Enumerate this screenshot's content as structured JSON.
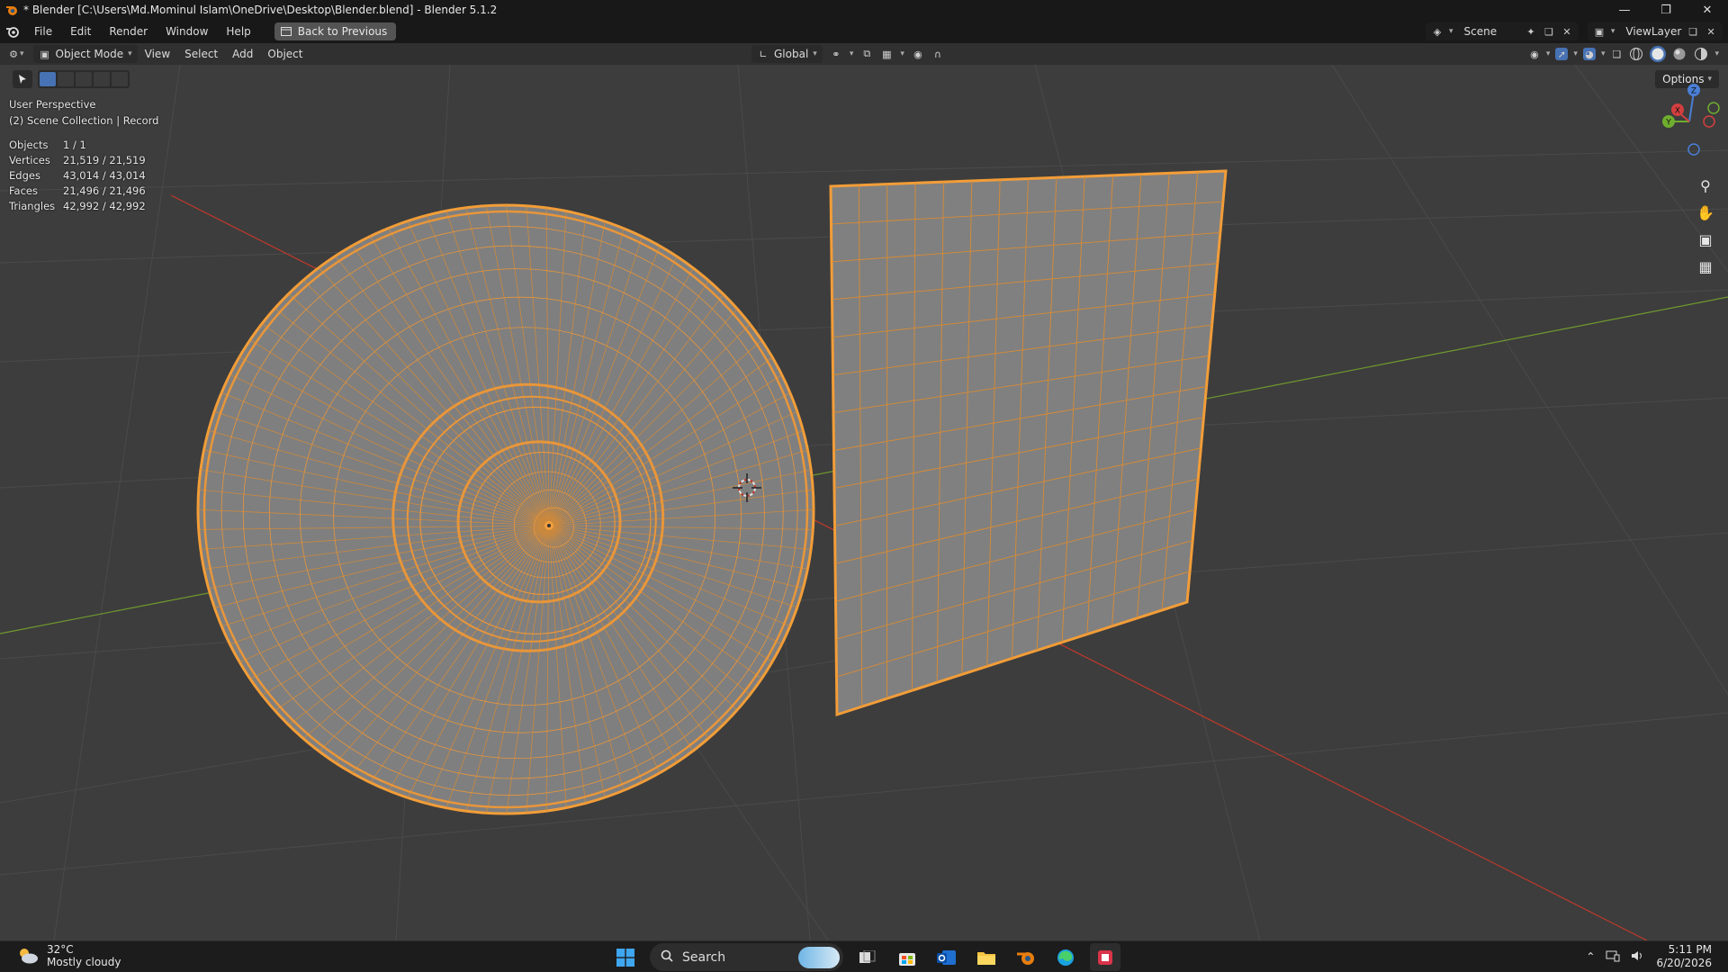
{
  "window": {
    "title": "* Blender [C:\\Users\\Md.Mominul Islam\\OneDrive\\Desktop\\Blender.blend] - Blender 5.1.2",
    "minimize_icon": "minimize-icon",
    "maximize_icon": "restore-icon",
    "close_icon": "close-icon"
  },
  "menu": {
    "items": [
      "File",
      "Edit",
      "Render",
      "Window",
      "Help"
    ],
    "back_button": "Back to Previous"
  },
  "scene": {
    "label": "Scene",
    "view_layer": "ViewLayer"
  },
  "viewport_header": {
    "mode": "Object Mode",
    "menus": [
      "View",
      "Select",
      "Add",
      "Object"
    ],
    "orientation": "Global"
  },
  "viewport": {
    "perspective": "User Perspective",
    "collection": "(2) Scene Collection | Record",
    "options_label": "Options",
    "stats": [
      {
        "label": "Objects",
        "value": "1 / 1"
      },
      {
        "label": "Vertices",
        "value": "21,519 / 21,519"
      },
      {
        "label": "Edges",
        "value": "43,014 / 43,014"
      },
      {
        "label": "Faces",
        "value": "21,496 / 21,496"
      },
      {
        "label": "Triangles",
        "value": "42,992 / 42,992"
      }
    ],
    "gizmo_axes": {
      "z": "Z",
      "y": "Y",
      "x": "X"
    },
    "colors": {
      "background": "#3d3d3d",
      "grid": "#4a4a4a",
      "x_axis": "#c0392b",
      "y_axis": "#6f9a2e",
      "selection": "#f29d38",
      "mesh": "#808080"
    }
  },
  "taskbar": {
    "weather_temp": "32°C",
    "weather_desc": "Mostly cloudy",
    "search_label": "Search",
    "time": "5:11 PM",
    "date": "6/20/2026"
  }
}
